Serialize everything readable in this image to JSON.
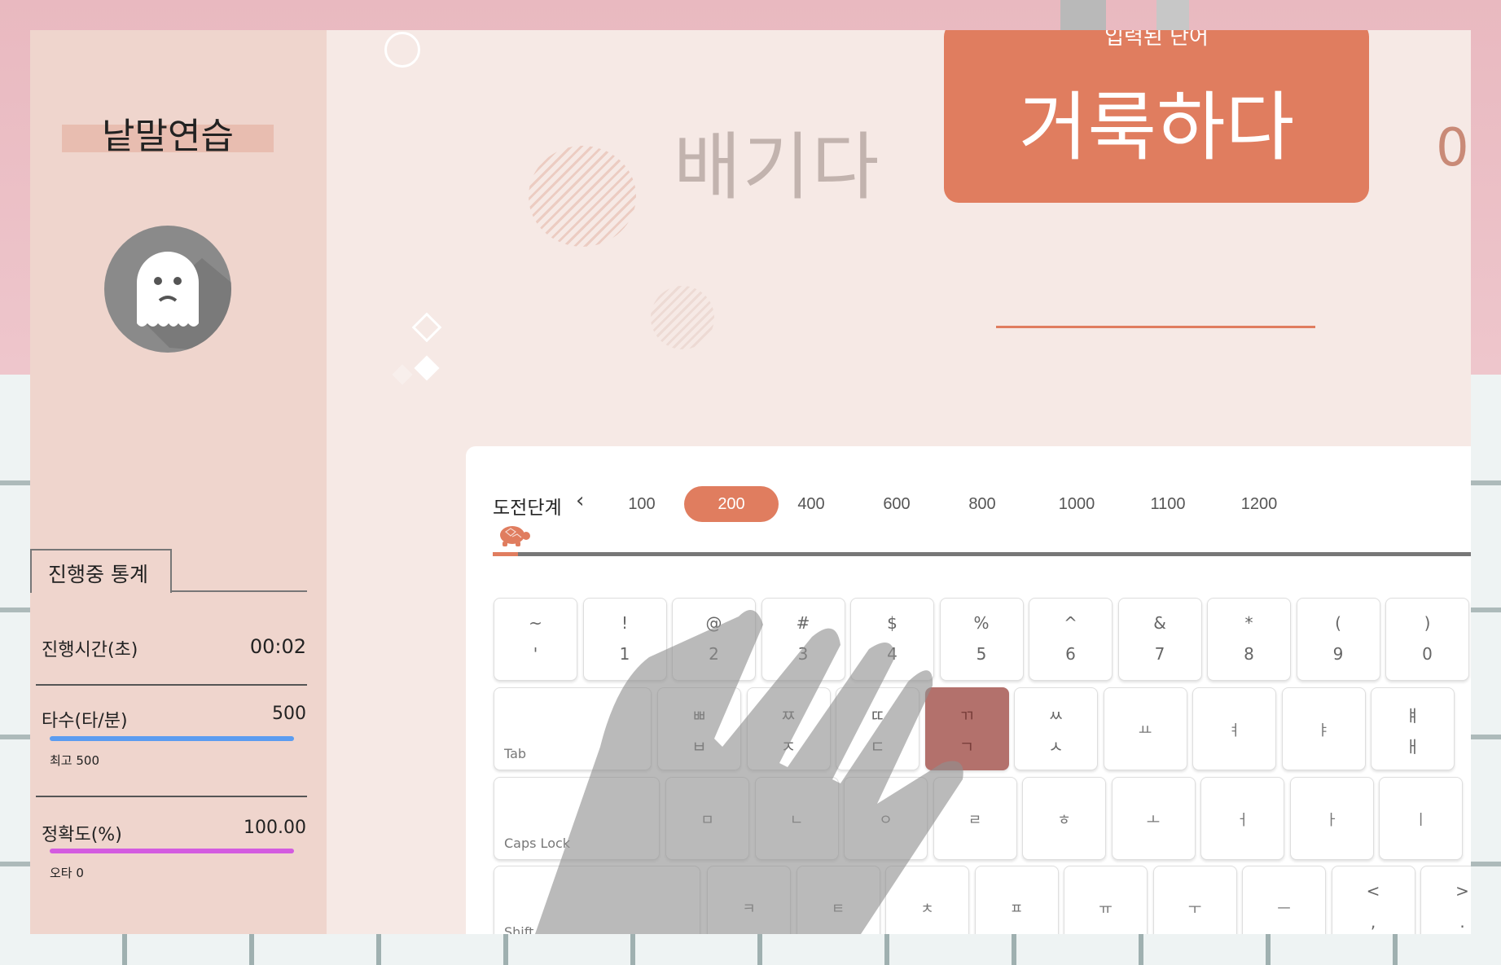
{
  "app": {
    "logo": "낱말연습"
  },
  "stats": {
    "tab_label": "진행중 통계",
    "time": {
      "label": "진행시간(초)",
      "value": "00:02"
    },
    "speed": {
      "label": "타수(타/분)",
      "value": "500",
      "sub": "최고 500",
      "fill": 1.0,
      "color": "#5b9cf0"
    },
    "accuracy": {
      "label": "정확도(%)",
      "value": "100.00",
      "sub": "오타 0",
      "fill": 1.0,
      "color": "#d45be0"
    }
  },
  "words": {
    "previous": "배기다",
    "current": "거룩하다",
    "current_top_peek": "입력된 단어",
    "next_peek": "0"
  },
  "levels": {
    "label": "도전단계",
    "items": [
      "100",
      "200",
      "400",
      "600",
      "800",
      "1000",
      "1100",
      "1200"
    ],
    "selected": "200",
    "progress": 0.025
  },
  "keyboard": {
    "row1": [
      {
        "top": "~",
        "bot": "'"
      },
      {
        "top": "!",
        "bot": "1"
      },
      {
        "top": "@",
        "bot": "2"
      },
      {
        "top": "#",
        "bot": "3"
      },
      {
        "top": "$",
        "bot": "4"
      },
      {
        "top": "%",
        "bot": "5"
      },
      {
        "top": "^",
        "bot": "6"
      },
      {
        "top": "&",
        "bot": "7"
      },
      {
        "top": "*",
        "bot": "8"
      },
      {
        "top": "(",
        "bot": "9"
      },
      {
        "top": ")",
        "bot": "0"
      }
    ],
    "row2": {
      "modifier": "Tab",
      "keys": [
        {
          "top": "ㅃ",
          "bot": "ㅂ"
        },
        {
          "top": "ㅉ",
          "bot": "ㅈ"
        },
        {
          "top": "ㄸ",
          "bot": "ㄷ"
        },
        {
          "top": "ㄲ",
          "bot": "ㄱ"
        },
        {
          "top": "ㅆ",
          "bot": "ㅅ"
        },
        {
          "mid": "ㅛ"
        },
        {
          "mid": "ㅕ"
        },
        {
          "mid": "ㅑ"
        },
        {
          "top": "ㅒ",
          "bot": "ㅐ"
        }
      ],
      "highlighted_index": 3
    },
    "row3": {
      "modifier": "Caps Lock",
      "keys": [
        "ㅁ",
        "ㄴ",
        "ㅇ",
        "ㄹ",
        "ㅎ",
        "ㅗ",
        "ㅓ",
        "ㅏ",
        "ㅣ"
      ]
    },
    "row4": {
      "modifier": "Shift",
      "keys": [
        {
          "mid": "ㅋ"
        },
        {
          "mid": "ㅌ"
        },
        {
          "mid": "ㅊ"
        },
        {
          "mid": "ㅍ"
        },
        {
          "mid": "ㅠ"
        },
        {
          "mid": "ㅜ"
        },
        {
          "mid": "ㅡ"
        },
        {
          "top": "<",
          "bot": ","
        },
        {
          "top": ">",
          "bot": "."
        }
      ]
    }
  },
  "colors": {
    "accent": "#e07d5f",
    "sidebar": "#efd5cd",
    "main_bg": "#f6e9e5"
  },
  "icons": {
    "avatar": "ghost-icon",
    "progress_marker": "turtle-icon",
    "prev": "chevron-left-icon",
    "next": "chevron-right-icon"
  }
}
